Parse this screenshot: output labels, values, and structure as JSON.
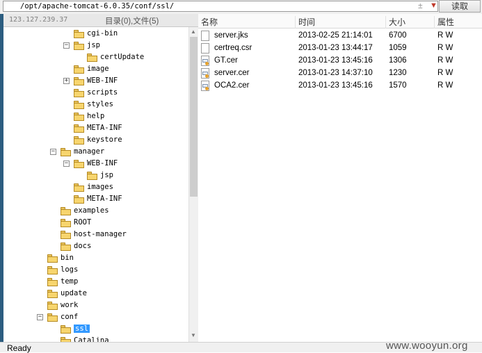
{
  "path_bar": {
    "path": "/opt/apache-tomcat-6.0.35/conf/ssl/",
    "read_button": "读取"
  },
  "tree_header": {
    "ip": "123.127.239.37",
    "counts": "目录(0),文件(5)"
  },
  "tree": [
    {
      "label": "cgi-bin",
      "depth": 3,
      "expander": ""
    },
    {
      "label": "jsp",
      "depth": 3,
      "expander": "−"
    },
    {
      "label": "certUpdate",
      "depth": 4,
      "expander": ""
    },
    {
      "label": "image",
      "depth": 3,
      "expander": ""
    },
    {
      "label": "WEB-INF",
      "depth": 3,
      "expander": "+"
    },
    {
      "label": "scripts",
      "depth": 3,
      "expander": ""
    },
    {
      "label": "styles",
      "depth": 3,
      "expander": ""
    },
    {
      "label": "help",
      "depth": 3,
      "expander": ""
    },
    {
      "label": "META-INF",
      "depth": 3,
      "expander": ""
    },
    {
      "label": "keystore",
      "depth": 3,
      "expander": ""
    },
    {
      "label": "manager",
      "depth": 2,
      "expander": "−"
    },
    {
      "label": "WEB-INF",
      "depth": 3,
      "expander": "−"
    },
    {
      "label": "jsp",
      "depth": 4,
      "expander": ""
    },
    {
      "label": "images",
      "depth": 3,
      "expander": ""
    },
    {
      "label": "META-INF",
      "depth": 3,
      "expander": ""
    },
    {
      "label": "examples",
      "depth": 2,
      "expander": ""
    },
    {
      "label": "ROOT",
      "depth": 2,
      "expander": ""
    },
    {
      "label": "host-manager",
      "depth": 2,
      "expander": ""
    },
    {
      "label": "docs",
      "depth": 2,
      "expander": ""
    },
    {
      "label": "bin",
      "depth": 1,
      "expander": ""
    },
    {
      "label": "logs",
      "depth": 1,
      "expander": ""
    },
    {
      "label": "temp",
      "depth": 1,
      "expander": ""
    },
    {
      "label": "update",
      "depth": 1,
      "expander": ""
    },
    {
      "label": "work",
      "depth": 1,
      "expander": ""
    },
    {
      "label": "conf",
      "depth": 1,
      "expander": "−"
    },
    {
      "label": "ssl",
      "depth": 2,
      "expander": "",
      "selected": true
    },
    {
      "label": "Catalina",
      "depth": 2,
      "expander": ""
    }
  ],
  "file_columns": {
    "name": "名称",
    "time": "时间",
    "size": "大小",
    "attr": "属性"
  },
  "files": [
    {
      "name": "server.jks",
      "time": "2013-02-25 21:14:01",
      "size": "6700",
      "attr": "R W",
      "icon": "file-icon"
    },
    {
      "name": "certreq.csr",
      "time": "2013-01-23 13:44:17",
      "size": "1059",
      "attr": "R W",
      "icon": "file-icon"
    },
    {
      "name": "GT.cer",
      "time": "2013-01-23 13:45:16",
      "size": "1306",
      "attr": "R W",
      "icon": "certificate-icon"
    },
    {
      "name": "server.cer",
      "time": "2013-01-23 14:37:10",
      "size": "1230",
      "attr": "R W",
      "icon": "certificate-icon"
    },
    {
      "name": "OCA2.cer",
      "time": "2013-01-23 13:45:16",
      "size": "1570",
      "attr": "R W",
      "icon": "certificate-icon"
    }
  ],
  "status": {
    "text": "Ready",
    "watermark": "www.wooyun.org"
  },
  "colors": {
    "selection": "#3399ff",
    "folder": "#f7d56e",
    "window_edge": "#2c5d80"
  }
}
